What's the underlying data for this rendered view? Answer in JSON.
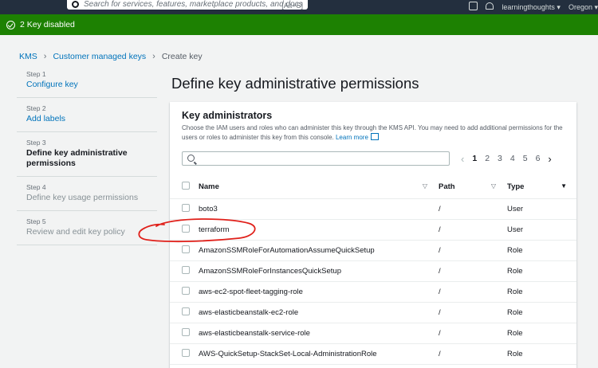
{
  "topnav": {
    "search_placeholder": "Search for services, features, marketplace products, and docs",
    "search_shortcut": "[Alt+S]",
    "account": "learningthoughts ▾",
    "region": "Oregon ▾"
  },
  "flash": {
    "message": "2 Key disabled"
  },
  "breadcrumb": {
    "items": [
      {
        "label": "KMS"
      },
      {
        "label": "Customer managed keys"
      },
      {
        "label": "Create key"
      }
    ]
  },
  "steps": [
    {
      "num": "Step 1",
      "label": "Configure key"
    },
    {
      "num": "Step 2",
      "label": "Add labels"
    },
    {
      "num": "Step 3",
      "label": "Define key administrative permissions"
    },
    {
      "num": "Step 4",
      "label": "Define key usage permissions"
    },
    {
      "num": "Step 5",
      "label": "Review and edit key policy"
    }
  ],
  "page": {
    "title": "Define key administrative permissions"
  },
  "panel": {
    "title": "Key administrators",
    "description": "Choose the IAM users and roles who can administer this key through the KMS API. You may need to add additional permissions for the users or roles to administer this key from this console.",
    "learn_more": "Learn more",
    "filter_value": ""
  },
  "pager": {
    "prev": "‹",
    "pages": [
      "1",
      "2",
      "3",
      "4",
      "5",
      "6"
    ],
    "next": "›"
  },
  "table": {
    "headers": {
      "name": "Name",
      "path": "Path",
      "type": "Type"
    },
    "rows": [
      {
        "name": "boto3",
        "path": "/",
        "type": "User"
      },
      {
        "name": "terraform",
        "path": "/",
        "type": "User"
      },
      {
        "name": "AmazonSSMRoleForAutomationAssumeQuickSetup",
        "path": "/",
        "type": "Role"
      },
      {
        "name": "AmazonSSMRoleForInstancesQuickSetup",
        "path": "/",
        "type": "Role"
      },
      {
        "name": "aws-ec2-spot-fleet-tagging-role",
        "path": "/",
        "type": "Role"
      },
      {
        "name": "aws-elasticbeanstalk-ec2-role",
        "path": "/",
        "type": "Role"
      },
      {
        "name": "aws-elasticbeanstalk-service-role",
        "path": "/",
        "type": "Role"
      },
      {
        "name": "AWS-QuickSetup-StackSet-Local-AdministrationRole",
        "path": "/",
        "type": "Role"
      }
    ]
  },
  "colors": {
    "nav_bg": "#232f3e",
    "success": "#1d8102",
    "link": "#0073bb",
    "annotation": "#e0201a"
  },
  "icons": [
    "search-icon",
    "external-link-icon",
    "bell-icon",
    "success-check-icon",
    "sort-icon"
  ]
}
